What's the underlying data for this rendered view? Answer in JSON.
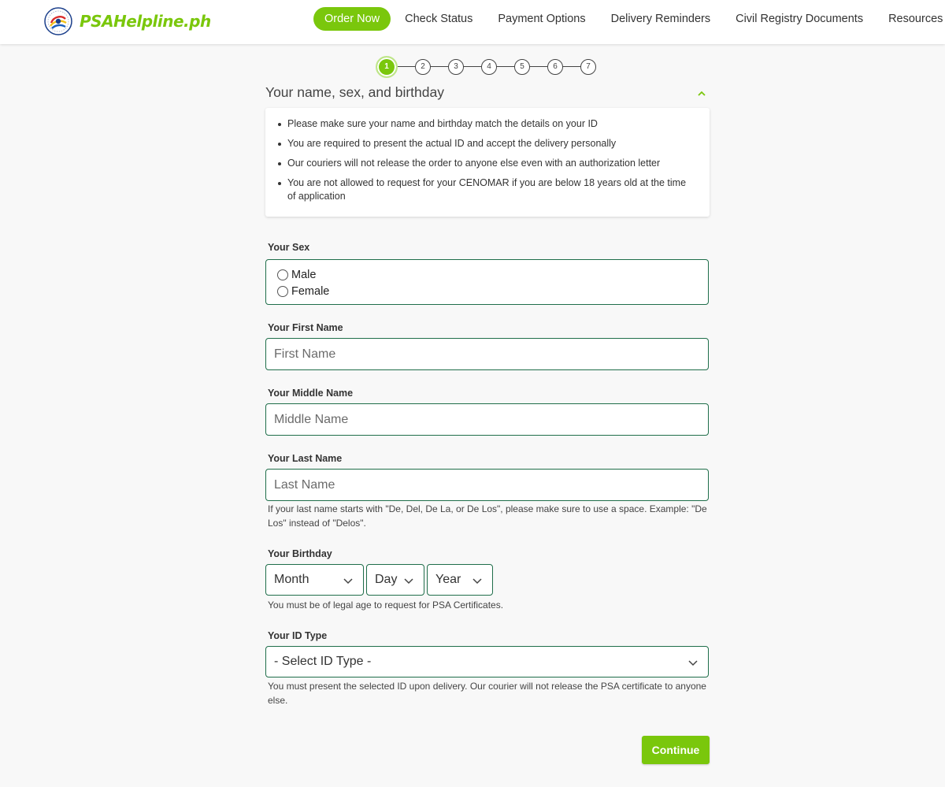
{
  "brand": {
    "name": "PSAHelpline.ph",
    "color": "#7ac70c",
    "seal_icon": "psa-seal-icon"
  },
  "nav": {
    "items": [
      {
        "label": "Order Now",
        "active": true
      },
      {
        "label": "Check Status"
      },
      {
        "label": "Payment Options"
      },
      {
        "label": "Delivery Reminders"
      },
      {
        "label": "Civil Registry Documents"
      },
      {
        "label": "Resources"
      }
    ]
  },
  "stepper": {
    "steps": [
      "1",
      "2",
      "3",
      "4",
      "5",
      "6",
      "7"
    ],
    "current": 1
  },
  "section": {
    "title": "Your name, sex, and birthday",
    "collapse_icon": "chevron-up-icon"
  },
  "info": {
    "items": [
      "Please make sure your name and birthday match the details on your ID",
      "You are required to present the actual ID and accept the delivery personally",
      "Our couriers will not release the order to anyone else even with an authorization letter",
      "You are not allowed to request for your CENOMAR if you are below 18 years old at the time of application"
    ]
  },
  "form": {
    "sex": {
      "label": "Your Sex",
      "options": [
        "Male",
        "Female"
      ]
    },
    "first_name": {
      "label": "Your First Name",
      "placeholder": "First Name",
      "value": ""
    },
    "middle_name": {
      "label": "Your Middle Name",
      "placeholder": "Middle Name",
      "value": ""
    },
    "last_name": {
      "label": "Your Last Name",
      "placeholder": "Last Name",
      "value": "",
      "help": "If your last name starts with \"De, Del, De La, or De Los\", please make sure to use a space. Example: \"De Los\" instead of \"Delos\"."
    },
    "birthday": {
      "label": "Your Birthday",
      "month": "Month",
      "day": "Day",
      "year": "Year",
      "help": "You must be of legal age to request for PSA Certificates."
    },
    "id_type": {
      "label": "Your ID Type",
      "selected": "- Select ID Type -",
      "help": "You must present the selected ID upon delivery. Our courier will not release the PSA certificate to anyone else."
    },
    "continue_label": "Continue"
  },
  "colors": {
    "accent": "#7ac70c",
    "input_border": "#1f6e4a",
    "background": "#f8f8f8"
  }
}
